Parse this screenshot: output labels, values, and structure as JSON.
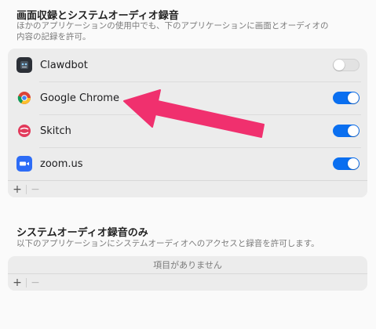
{
  "section1": {
    "title": "画面収録とシステムオーディオ録音",
    "desc_line1": "ほかのアプリケーションの使用中でも、下のアプリケーションに画面とオーディオの",
    "desc_line2": "内容の記録を許可。",
    "apps": [
      {
        "name": "Clawdbot",
        "icon": "clawdbot-icon",
        "enabled": false
      },
      {
        "name": "Google Chrome",
        "icon": "chrome-icon",
        "enabled": true
      },
      {
        "name": "Skitch",
        "icon": "skitch-icon",
        "enabled": true
      },
      {
        "name": "zoom.us",
        "icon": "zoom-icon",
        "enabled": true
      }
    ],
    "add_label": "+",
    "remove_label": "−"
  },
  "section2": {
    "title": "システムオーディオ録音のみ",
    "desc": "以下のアプリケーションにシステムオーディオへのアクセスと録音を許可します。",
    "empty_text": "項目がありません",
    "add_label": "+",
    "remove_label": "−"
  },
  "annotation": {
    "color": "#f0306e",
    "icon": "arrow-annotation"
  },
  "colors": {
    "toggle_on": "#0a6ff0",
    "toggle_off": "#e2e2e2"
  }
}
